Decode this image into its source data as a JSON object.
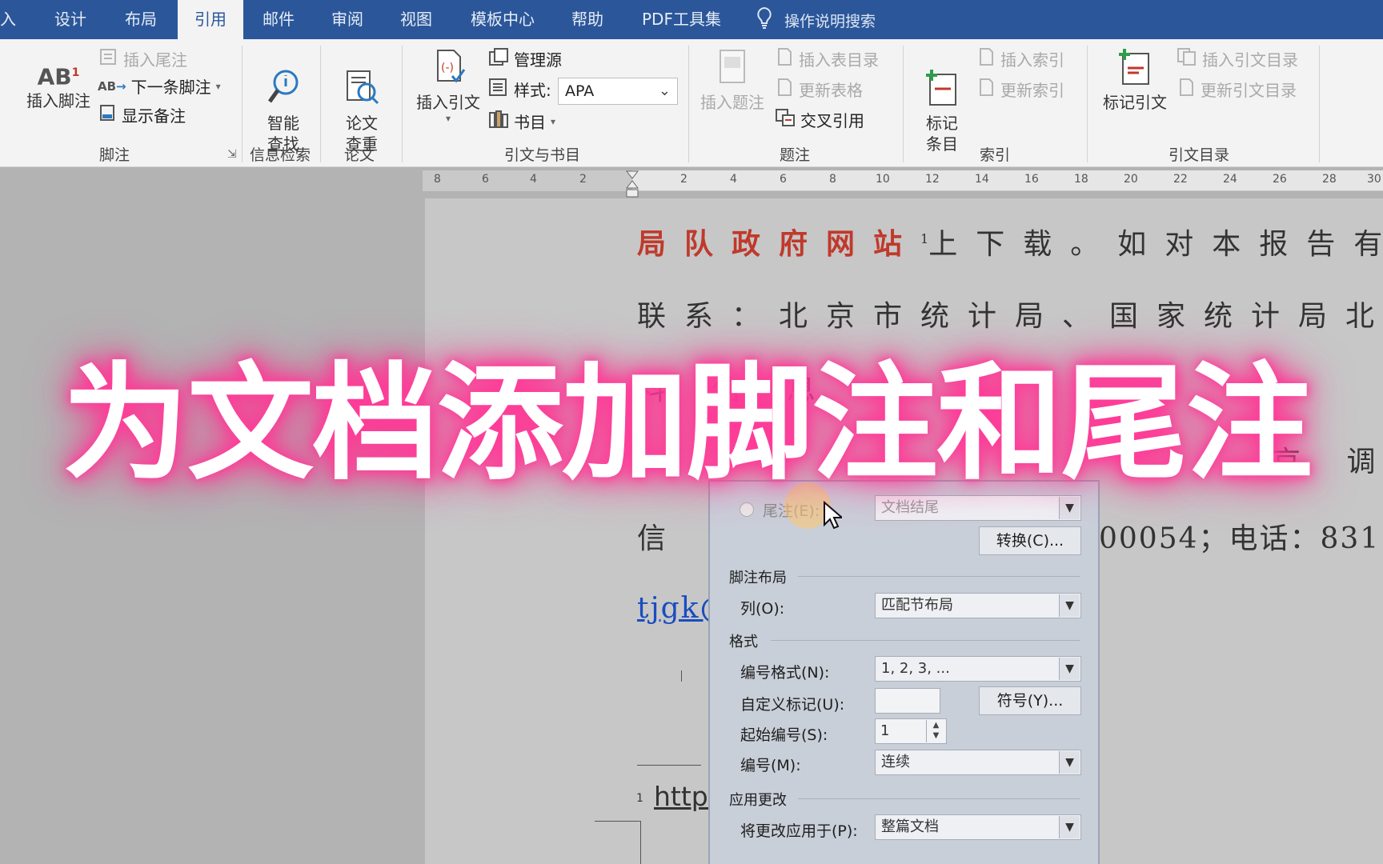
{
  "tabs": [
    {
      "label": "入",
      "active": false
    },
    {
      "label": "设计",
      "active": false
    },
    {
      "label": "布局",
      "active": false
    },
    {
      "label": "引用",
      "active": true
    },
    {
      "label": "邮件",
      "active": false
    },
    {
      "label": "审阅",
      "active": false
    },
    {
      "label": "视图",
      "active": false
    },
    {
      "label": "模板中心",
      "active": false
    },
    {
      "label": "帮助",
      "active": false
    },
    {
      "label": "PDF工具集",
      "active": false
    }
  ],
  "tell_me": {
    "label": "操作说明搜索",
    "icon": "lightbulb-icon"
  },
  "ribbon": {
    "footnotes": {
      "insert_footnote": "插入脚注",
      "insert_endnote": "插入尾注",
      "next_footnote": "下一条脚注",
      "show_notes": "显示备注",
      "group_label": "脚注"
    },
    "research": {
      "smart_lookup": "智能\n查找",
      "group_label": "信息检索"
    },
    "thesis": {
      "check": "论文\n查重",
      "group_label": "论文"
    },
    "citations": {
      "insert_citation": "插入引文",
      "manage_sources": "管理源",
      "style_label": "样式:",
      "style_value": "APA",
      "bibliography": "书目",
      "group_label": "引文与书目"
    },
    "captions": {
      "insert_caption": "插入题注",
      "insert_table_of_figures": "插入表目录",
      "update_table": "更新表格",
      "cross_reference": "交叉引用",
      "group_label": "题注"
    },
    "index": {
      "mark_entry": "标记\n条目",
      "insert_index": "插入索引",
      "update_index": "更新索引",
      "group_label": "索引"
    },
    "toa": {
      "mark_citation": "标记引文",
      "insert_toa": "插入引文目录",
      "update_toa": "更新引文目录",
      "group_label": "引文目录"
    }
  },
  "ruler": {
    "ticks": [
      "8",
      "6",
      "4",
      "2",
      "2",
      "4",
      "6",
      "8",
      "10",
      "12",
      "14",
      "16",
      "18",
      "20",
      "22",
      "24",
      "26",
      "28",
      "30"
    ]
  },
  "document": {
    "line1_red": "局队政府网站",
    "line1_sup": "1",
    "line1_rest": "上下载。如对本报告有",
    "line2": "联系：北京市统计局、国家统计局北京",
    "line3": "料 信 息",
    "line4_right": "京 调",
    "line5_left": "信 息",
    "line5_right": "00054；电话：831",
    "link_fragment": "tjgk@",
    "footnote_no": "1",
    "footnote_text": "http:"
  },
  "dialog": {
    "endnote_label": "尾注(E):",
    "endnote_value": "文档结尾",
    "convert_button": "转换(C)...",
    "layout_section": "脚注布局",
    "columns_label": "列(O):",
    "columns_value": "匹配节布局",
    "format_section": "格式",
    "number_format_label": "编号格式(N):",
    "number_format_value": "1, 2, 3, ...",
    "custom_mark_label": "自定义标记(U):",
    "custom_mark_value": "",
    "symbol_button": "符号(Y)...",
    "start_at_label": "起始编号(S):",
    "start_at_value": "1",
    "numbering_label": "编号(M):",
    "numbering_value": "连续",
    "apply_section": "应用更改",
    "apply_to_label": "将更改应用于(P):",
    "apply_to_value": "整篇文档"
  },
  "overlay_title": "为文档添加脚注和尾注",
  "colors": {
    "tab_bar": "#2b579a",
    "ribbon": "#f3f3f3",
    "title_glow": "#ff3d9a",
    "red_text": "#c0392b",
    "link": "#1a4cc0"
  }
}
